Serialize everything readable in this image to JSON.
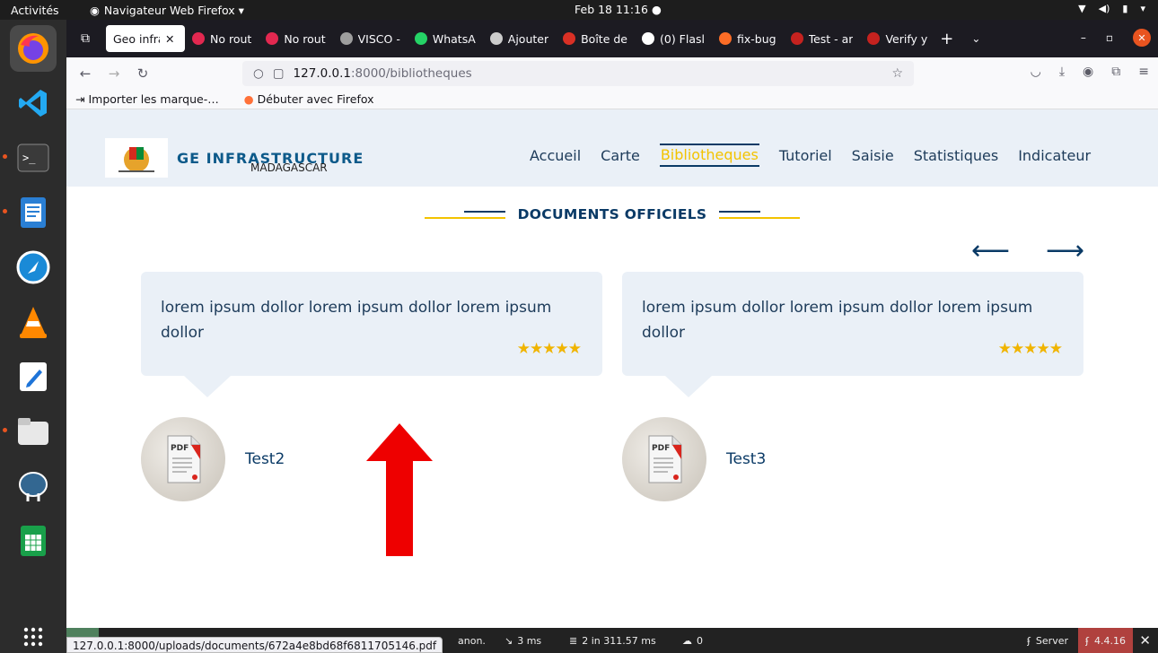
{
  "system": {
    "activities": "Activités",
    "app_name": "Navigateur Web Firefox ▾",
    "clock": "Feb 18  11:16  ●"
  },
  "tabs": [
    {
      "label": "Geo infra",
      "color": "#ffffff"
    },
    {
      "label": "No rout",
      "color": "#e22850"
    },
    {
      "label": "No rout",
      "color": "#e22850"
    },
    {
      "label": "VISCO -",
      "color": "#9e9e9e"
    },
    {
      "label": "WhatsA",
      "color": "#25d366"
    },
    {
      "label": "Ajouter",
      "color": "#cccccc"
    },
    {
      "label": "Boîte de",
      "color": "#d93025"
    },
    {
      "label": "(0) Flasl",
      "color": "#ffffff"
    },
    {
      "label": "fix-bug",
      "color": "#fc6d26"
    },
    {
      "label": "Test - ar",
      "color": "#c5221f"
    },
    {
      "label": "Verify y",
      "color": "#c5221f"
    }
  ],
  "urlbar": {
    "host": "127.0.0.1",
    "path": ":8000/bibliotheques"
  },
  "bookmarks": [
    {
      "label": "Importer les marque-…"
    },
    {
      "label": "Débuter avec Firefox"
    }
  ],
  "site": {
    "logo_text": "GE  INFRASTRUCTURE",
    "logo_sub": "MADAGASCAR",
    "menu": [
      "Accueil",
      "Carte",
      "Bibliotheques",
      "Tutoriel",
      "Saisie",
      "Statistiques",
      "Indicateur"
    ],
    "section_title": "DOCUMENTS OFFICIELS",
    "cards": [
      {
        "quote": "lorem ipsum dollor lorem ipsum dollor lorem ipsum dollor",
        "rating": 5,
        "name": "Test2"
      },
      {
        "quote": "lorem ipsum dollor lorem ipsum dollor lorem ipsum dollor",
        "rating": 5,
        "name": "Test3"
      }
    ],
    "stars_text": "★★★★★",
    "prev_arrow": "⟵",
    "next_arrow": "⟶"
  },
  "sfbar": {
    "status_url": "127.0.0.1:8000/uploads/documents/672a4e8bd68f6811705146.pdf",
    "user": "anon.",
    "time": "3 ms",
    "db": "2 in 311.57 ms",
    "cache": "0",
    "server": "Server",
    "version": "4.4.16"
  },
  "colors": {
    "accent_yellow": "#f3c300",
    "navy": "#0a3a66",
    "card_bg": "#eaf0f7",
    "arrow_red": "#ee0000"
  }
}
